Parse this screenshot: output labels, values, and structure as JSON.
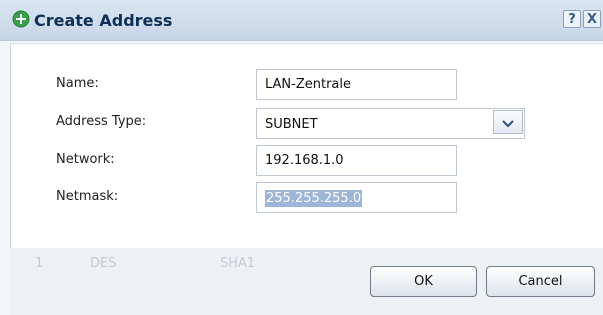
{
  "dialog": {
    "title": "Create Address",
    "help_label": "?",
    "close_label": "X"
  },
  "form": {
    "name_label": "Name:",
    "name_value": "LAN-Zentrale",
    "type_label": "Address Type:",
    "type_value": "SUBNET",
    "network_label": "Network:",
    "network_value": "192.168.1.0",
    "netmask_label": "Netmask:",
    "netmask_value": "255.255.255.0"
  },
  "background_table": {
    "cells": [
      "1",
      "DES",
      "SHA1"
    ]
  },
  "buttons": {
    "ok": "OK",
    "cancel": "Cancel"
  },
  "colors": {
    "title_text": "#0f2f57",
    "selection": "#9db6d8",
    "add_icon": "#3aa14b"
  }
}
